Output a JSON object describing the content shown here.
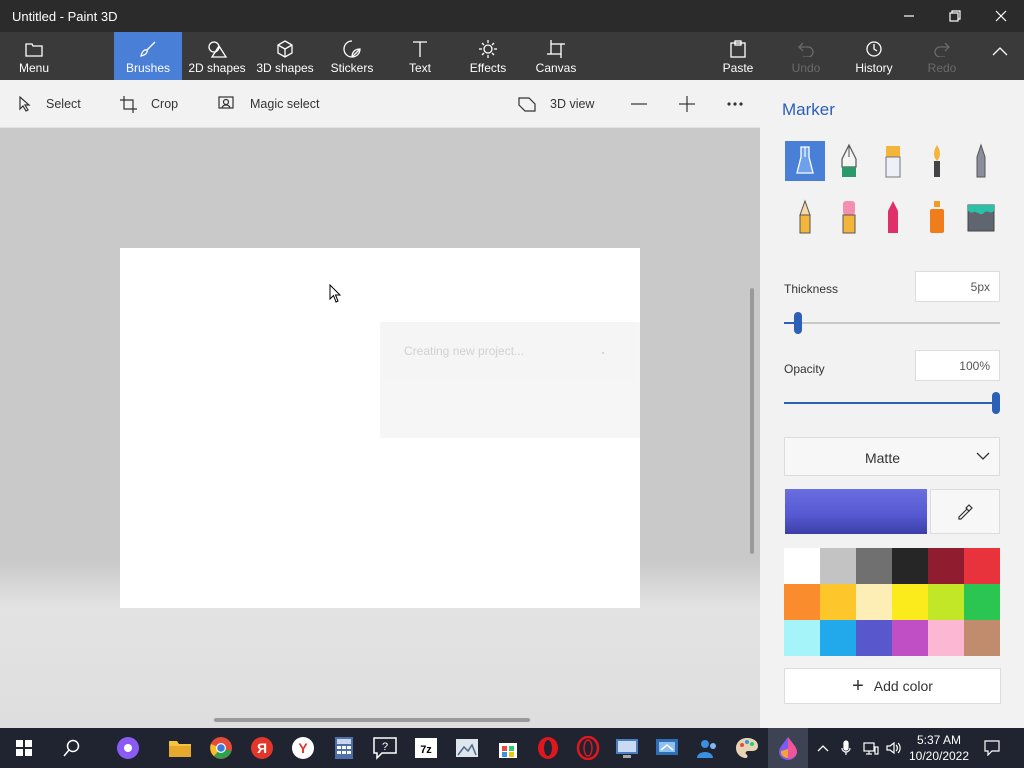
{
  "window": {
    "title": "Untitled - Paint 3D"
  },
  "ribbon": {
    "menu": "Menu",
    "brushes": "Brushes",
    "shapes2d": "2D shapes",
    "shapes3d": "3D shapes",
    "stickers": "Stickers",
    "text": "Text",
    "effects": "Effects",
    "canvas": "Canvas",
    "paste": "Paste",
    "undo": "Undo",
    "history": "History",
    "redo": "Redo"
  },
  "toolbar": {
    "select": "Select",
    "crop": "Crop",
    "magic_select": "Magic select",
    "view3d": "3D view"
  },
  "canvas": {
    "toast": "Creating new project..."
  },
  "panel": {
    "title": "Marker",
    "thickness_label": "Thickness",
    "thickness_value": "5px",
    "thickness_level": 0.05,
    "opacity_label": "Opacity",
    "opacity_value": "100%",
    "opacity_level": 1.0,
    "finish": "Matte",
    "current_color": "#5558d0",
    "add_color": "Add color",
    "brushes": [
      "marker",
      "calligraphy-pen",
      "oil-brush",
      "watercolor",
      "pixel-pen",
      "pencil",
      "eraser",
      "crayon",
      "spray-can",
      "fill-bucket"
    ],
    "swatches": [
      "#ffffff",
      "#c3c3c3",
      "#707070",
      "#262626",
      "#8f1d2f",
      "#e8323c",
      "#fb8c2e",
      "#fdc72b",
      "#fdeeb5",
      "#fbeb1d",
      "#c2e727",
      "#2bc552",
      "#a5f4fa",
      "#22a9ec",
      "#5858cc",
      "#c04fc6",
      "#fcb7d3",
      "#c08c6d"
    ]
  },
  "taskbar": {
    "time": "5:37 AM",
    "date": "10/20/2022"
  }
}
